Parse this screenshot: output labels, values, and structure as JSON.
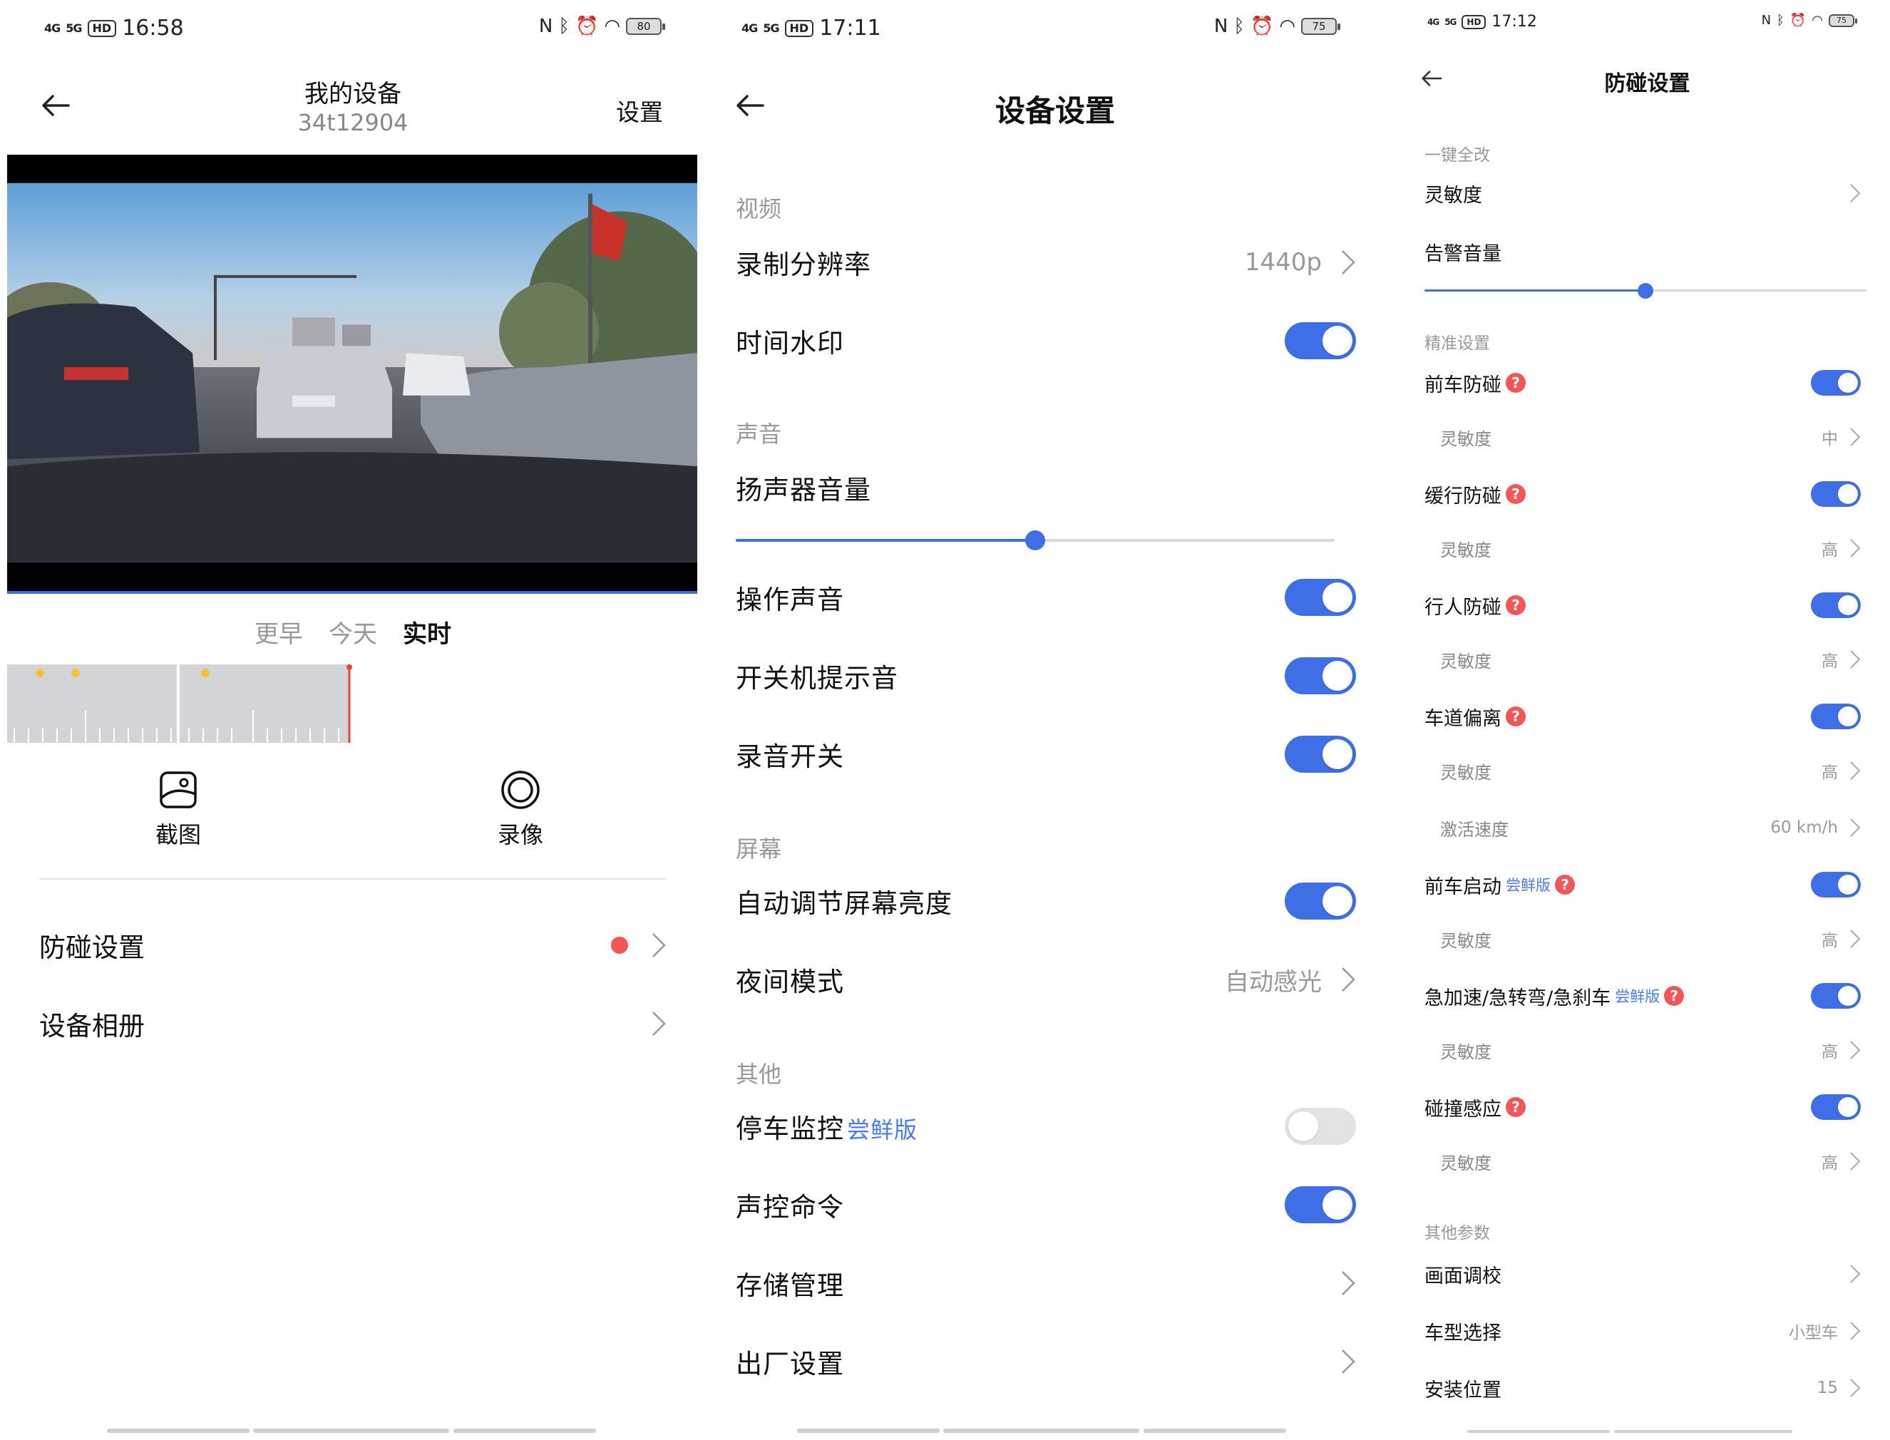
{
  "panel1": {
    "status": {
      "time": "16:58",
      "net1": "4G",
      "net2": "5G",
      "hd": "HD",
      "battery": "80"
    },
    "title": "我的设备",
    "subtitle": "34t12904",
    "settings_link": "设置",
    "timeline_tabs": [
      {
        "label": "更早",
        "active": false
      },
      {
        "label": "今天",
        "active": false
      },
      {
        "label": "实时",
        "active": true
      }
    ],
    "actions": [
      {
        "label": "截图",
        "icon": "screenshot-icon"
      },
      {
        "label": "录像",
        "icon": "record-icon"
      }
    ],
    "menu": [
      {
        "label": "防碰设置",
        "has_dot": true
      },
      {
        "label": "设备相册",
        "has_dot": false
      }
    ]
  },
  "panel2": {
    "status": {
      "time": "17:11",
      "net1": "4G",
      "net2": "5G",
      "hd": "HD",
      "battery": "75"
    },
    "title": "设备设置",
    "sections": {
      "video": "视频",
      "sound": "声音",
      "screen": "屏幕",
      "other": "其他"
    },
    "rows": {
      "resolution": {
        "label": "录制分辨率",
        "value": "1440p"
      },
      "watermark": {
        "label": "时间水印",
        "on": true
      },
      "speaker_volume": {
        "label": "扬声器音量",
        "level": 0.5
      },
      "op_sound": {
        "label": "操作声音",
        "on": true
      },
      "power_sound": {
        "label": "开关机提示音",
        "on": true
      },
      "rec_audio": {
        "label": "录音开关",
        "on": true
      },
      "auto_brightness": {
        "label": "自动调节屏幕亮度",
        "on": true
      },
      "night_mode": {
        "label": "夜间模式",
        "value": "自动感光"
      },
      "parking": {
        "label": "停车监控",
        "tag": "尝鲜版",
        "on": false
      },
      "voice_cmd": {
        "label": "声控命令",
        "on": true
      },
      "storage": {
        "label": "存储管理"
      },
      "factory": {
        "label": "出厂设置"
      }
    }
  },
  "panel3": {
    "status": {
      "time": "17:12",
      "net1": "4G",
      "net2": "5G",
      "hd": "HD",
      "battery": "75"
    },
    "title": "防碰设置",
    "sections": {
      "one_key": "一键全改",
      "precise": "精准设置",
      "other": "其他参数"
    },
    "one_key_sensitivity": "灵敏度",
    "alarm_volume": {
      "label": "告警音量",
      "level": 0.5
    },
    "features": [
      {
        "label": "前车防碰",
        "tag": "",
        "on": true,
        "sub_label": "灵敏度",
        "sub_value": "中"
      },
      {
        "label": "缓行防碰",
        "tag": "",
        "on": true,
        "sub_label": "灵敏度",
        "sub_value": "高"
      },
      {
        "label": "行人防碰",
        "tag": "",
        "on": true,
        "sub_label": "灵敏度",
        "sub_value": "高"
      },
      {
        "label": "车道偏离",
        "tag": "",
        "on": true,
        "sub_label": "灵敏度",
        "sub_value": "高"
      },
      {
        "label": "前车启动",
        "tag": "尝鲜版",
        "on": true,
        "sub_label": "灵敏度",
        "sub_value": "高"
      },
      {
        "label": "急加速/急转弯/急刹车",
        "tag": "尝鲜版",
        "on": true,
        "sub_label": "灵敏度",
        "sub_value": "高"
      },
      {
        "label": "碰撞感应",
        "tag": "",
        "on": true,
        "sub_label": "灵敏度",
        "sub_value": "高"
      }
    ],
    "activation_speed": {
      "label": "激活速度",
      "value": "60 km/h"
    },
    "help_glyph": "?",
    "other_rows": [
      {
        "label": "画面调校",
        "value": ""
      },
      {
        "label": "车型选择",
        "value": "小型车"
      },
      {
        "label": "安装位置",
        "value": "15"
      }
    ]
  },
  "colors": {
    "accent": "#3f6fe6",
    "badge_red": "#f25656",
    "muted": "#999999"
  }
}
